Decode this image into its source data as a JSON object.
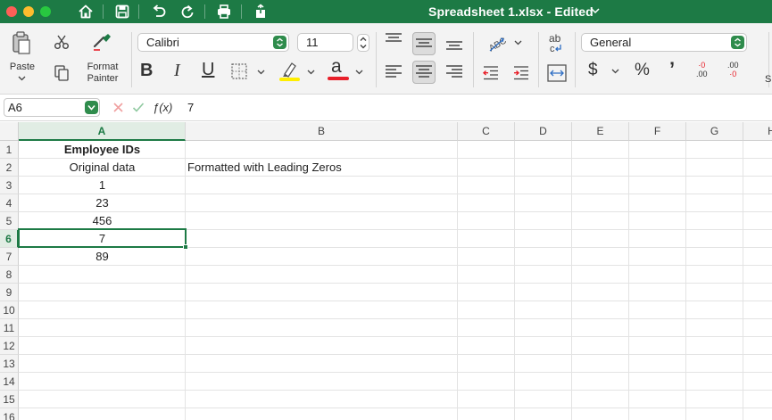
{
  "window": {
    "title": "Spreadsheet 1.xlsx - Edited",
    "colors": {
      "titlebar": "#1d7a45",
      "close": "#fe5f57",
      "minimize": "#febc2e",
      "zoom": "#28c840"
    }
  },
  "toolbar": {
    "icons": [
      "home-icon",
      "save-icon",
      "undo-icon",
      "redo-icon",
      "print-icon",
      "share-icon"
    ]
  },
  "ribbon": {
    "paste_label": "Paste",
    "format_painter_line1": "Format",
    "format_painter_line2": "Painter",
    "font_name": "Calibri",
    "font_size": "11",
    "bold_label": "B",
    "italic_label": "I",
    "underline_label": "U",
    "font_color_label": "a",
    "wrap_label": "ab",
    "number_format": "General",
    "currency_label": "$",
    "percent_label": "%",
    "comma_label": "’",
    "inc_decimal_top": "·0",
    "inc_decimal_bottom": ".00",
    "dec_decimal_top": ".00",
    "dec_decimal_bottom": "·0",
    "overflow_label": "S",
    "colors": {
      "highlight": "#ffee00",
      "font": "#e8202a"
    }
  },
  "formula_bar": {
    "name_box": "A6",
    "fx_label": "ƒ(x)",
    "value": "7"
  },
  "sheet": {
    "columns": [
      "A",
      "B",
      "C",
      "D",
      "E",
      "F",
      "G",
      "H"
    ],
    "rows": [
      "1",
      "2",
      "3",
      "4",
      "5",
      "6",
      "7",
      "8",
      "9",
      "10",
      "11",
      "12",
      "13",
      "14",
      "15",
      "16"
    ],
    "selected_cell": "A6",
    "cells": {
      "A1": "Employee IDs",
      "A2": "Original data",
      "B2": "Formatted with Leading Zeros",
      "A3": "1",
      "A4": "23",
      "A5": "456",
      "A6": "7",
      "A7": "89"
    }
  }
}
